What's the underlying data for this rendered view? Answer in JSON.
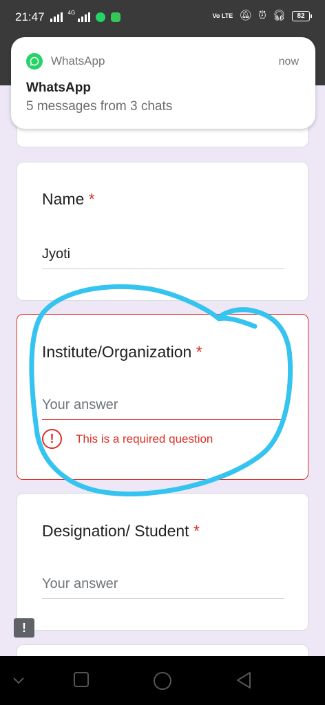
{
  "status_bar": {
    "time": "21:47",
    "network_tag": "4G",
    "volte": "Vo LTE",
    "battery": "82"
  },
  "notification": {
    "app_name": "WhatsApp",
    "time": "now",
    "title": "WhatsApp",
    "body": "5 messages from 3 chats"
  },
  "form": {
    "questions": [
      {
        "title": "Name",
        "required_mark": "*",
        "value": "Jyoti"
      },
      {
        "title": "Institute/Organization",
        "required_mark": "*",
        "placeholder": "Your answer",
        "error": "This is a required question"
      },
      {
        "title": "Designation/ Student",
        "required_mark": "*",
        "placeholder": "Your answer"
      }
    ]
  },
  "colors": {
    "accent_error": "#d93025",
    "annotation": "#35c3ef",
    "whatsapp": "#25d366",
    "background": "#ede7f6"
  },
  "icons": {
    "status": [
      "signal-icon",
      "whatsapp-icon",
      "app-icon",
      "volte-icon",
      "mute-icon",
      "alarm-icon",
      "headphones-icon",
      "battery-icon"
    ],
    "nav": [
      "chevron-down-icon",
      "recents-icon",
      "home-icon",
      "back-icon"
    ],
    "feedback": "feedback-icon"
  }
}
